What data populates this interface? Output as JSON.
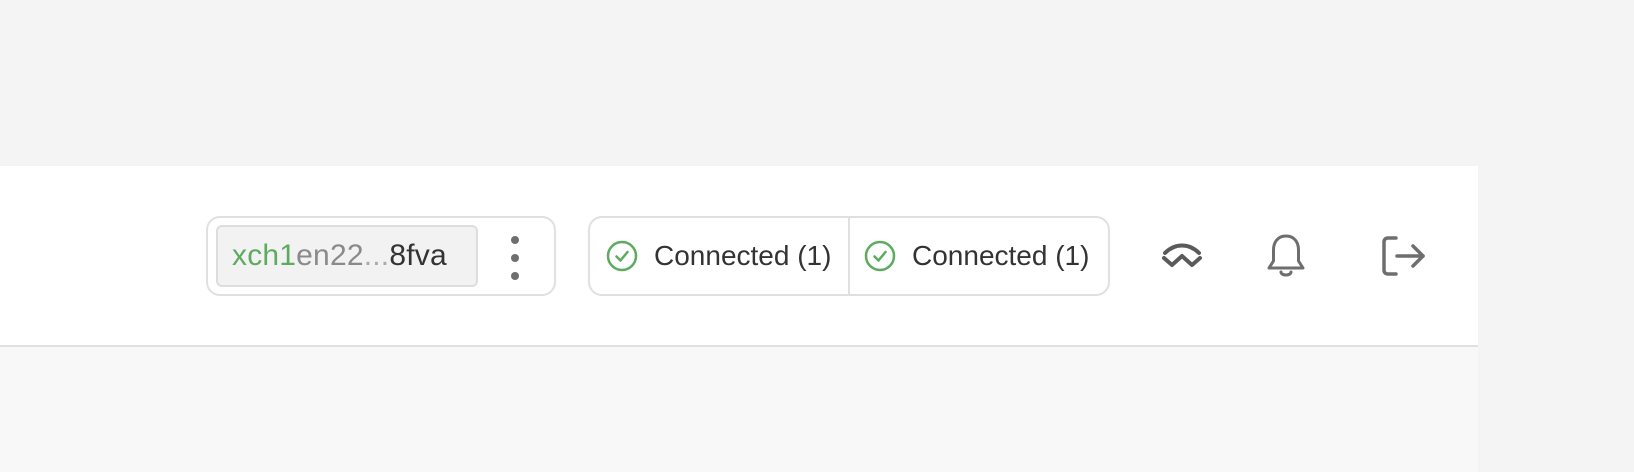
{
  "wallet": {
    "address_prefix": "xch1",
    "address_middle": "en22",
    "address_ellipsis": "...",
    "address_suffix": "8fva"
  },
  "connections": [
    {
      "label": "Connected (1)",
      "status_color": "#5cab5f"
    },
    {
      "label": "Connected (1)",
      "status_color": "#5cab5f"
    }
  ],
  "toolbar": {
    "icons": [
      "walletconnect-icon",
      "bell-icon",
      "logout-icon"
    ]
  },
  "colors": {
    "accent_green": "#5cab5f",
    "icon_gray": "#6e6e6e",
    "text_dark": "#333333"
  }
}
